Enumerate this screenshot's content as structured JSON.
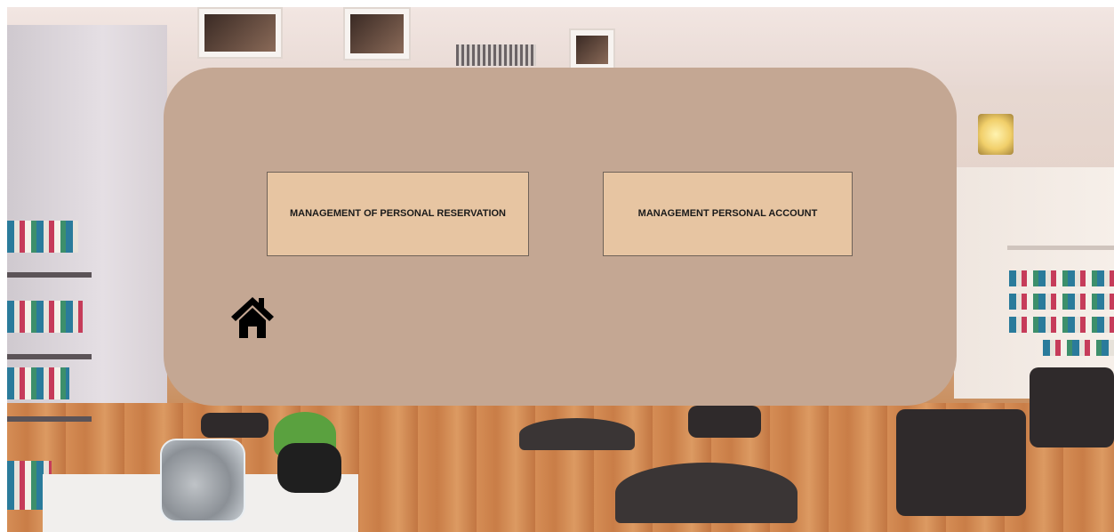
{
  "menu": {
    "reservation_label": "MANAGEMENT OF PERSONAL RESERVATION",
    "account_label": "MANAGEMENT PERSONAL ACCOUNT"
  },
  "icons": {
    "home": "home-icon"
  },
  "colors": {
    "panel": "#c4a793",
    "button": "#e7c5a2",
    "button_border": "#6f6258",
    "text": "#1a1a1a"
  }
}
